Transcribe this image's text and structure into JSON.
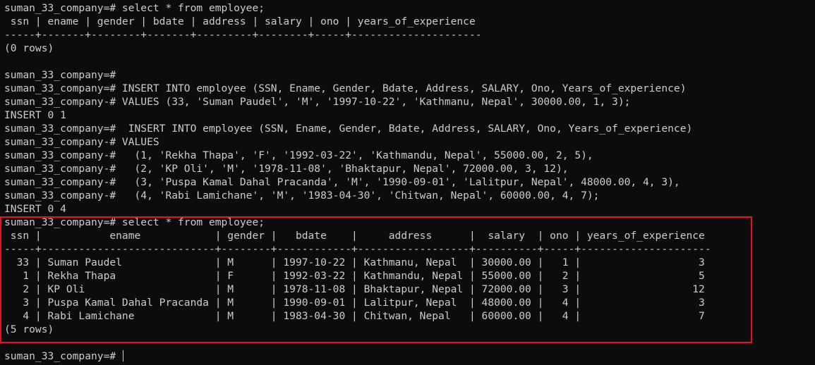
{
  "terminal": {
    "lines": [
      "suman_33_company=# select * from employee;",
      " ssn | ename | gender | bdate | address | salary | ono | years_of_experience",
      "-----+-------+--------+-------+---------+--------+-----+---------------------",
      "(0 rows)",
      "",
      "suman_33_company=#",
      "suman_33_company=# INSERT INTO employee (SSN, Ename, Gender, Bdate, Address, SALARY, Ono, Years_of_experience)",
      "suman_33_company-# VALUES (33, 'Suman Paudel', 'M', '1997-10-22', 'Kathmanu, Nepal', 30000.00, 1, 3);",
      "INSERT 0 1",
      "suman_33_company=#  INSERT INTO employee (SSN, Ename, Gender, Bdate, Address, SALARY, Ono, Years_of_experience)",
      "suman_33_company-# VALUES",
      "suman_33_company-#   (1, 'Rekha Thapa', 'F', '1992-03-22', 'Kathmandu, Nepal', 55000.00, 2, 5),",
      "suman_33_company-#   (2, 'KP Oli', 'M', '1978-11-08', 'Bhaktapur, Nepal', 72000.00, 3, 12),",
      "suman_33_company-#   (3, 'Puspa Kamal Dahal Pracanda', 'M', '1990-09-01', 'Lalitpur, Nepal', 48000.00, 4, 3),",
      "suman_33_company-#   (4, 'Rabi Lamichane', 'M', '1983-04-30', 'Chitwan, Nepal', 60000.00, 4, 7);",
      "INSERT 0 4",
      "suman_33_company=# select * from employee;",
      " ssn |           ename            | gender |   bdate    |     address      |  salary  | ono | years_of_experience",
      "-----+----------------------------+--------+------------+------------------+----------+-----+---------------------",
      "  33 | Suman Paudel               | M      | 1997-10-22 | Kathmanu, Nepal  | 30000.00 |   1 |                   3",
      "   1 | Rekha Thapa                | F      | 1992-03-22 | Kathmandu, Nepal | 55000.00 |   2 |                   5",
      "   2 | KP Oli                     | M      | 1978-11-08 | Bhaktapur, Nepal | 72000.00 |   3 |                  12",
      "   3 | Puspa Kamal Dahal Pracanda | M      | 1990-09-01 | Lalitpur, Nepal  | 48000.00 |   4 |                   3",
      "   4 | Rabi Lamichane             | M      | 1983-04-30 | Chitwan, Nepal   | 60000.00 |   4 |                   7",
      "(5 rows)",
      "",
      "suman_33_company=# "
    ]
  },
  "colors": {
    "background": "#0c0c0c",
    "text": "#cccccc",
    "highlight": "#e81123"
  }
}
